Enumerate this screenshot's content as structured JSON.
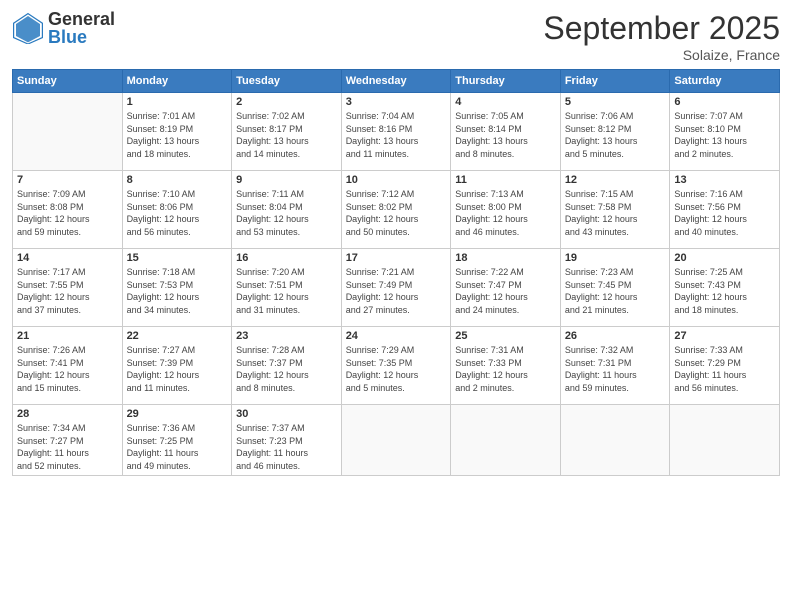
{
  "logo": {
    "general": "General",
    "blue": "Blue"
  },
  "header": {
    "month": "September 2025",
    "location": "Solaize, France"
  },
  "weekdays": [
    "Sunday",
    "Monday",
    "Tuesday",
    "Wednesday",
    "Thursday",
    "Friday",
    "Saturday"
  ],
  "weeks": [
    [
      {
        "day": "",
        "info": ""
      },
      {
        "day": "1",
        "info": "Sunrise: 7:01 AM\nSunset: 8:19 PM\nDaylight: 13 hours\nand 18 minutes."
      },
      {
        "day": "2",
        "info": "Sunrise: 7:02 AM\nSunset: 8:17 PM\nDaylight: 13 hours\nand 14 minutes."
      },
      {
        "day": "3",
        "info": "Sunrise: 7:04 AM\nSunset: 8:16 PM\nDaylight: 13 hours\nand 11 minutes."
      },
      {
        "day": "4",
        "info": "Sunrise: 7:05 AM\nSunset: 8:14 PM\nDaylight: 13 hours\nand 8 minutes."
      },
      {
        "day": "5",
        "info": "Sunrise: 7:06 AM\nSunset: 8:12 PM\nDaylight: 13 hours\nand 5 minutes."
      },
      {
        "day": "6",
        "info": "Sunrise: 7:07 AM\nSunset: 8:10 PM\nDaylight: 13 hours\nand 2 minutes."
      }
    ],
    [
      {
        "day": "7",
        "info": "Sunrise: 7:09 AM\nSunset: 8:08 PM\nDaylight: 12 hours\nand 59 minutes."
      },
      {
        "day": "8",
        "info": "Sunrise: 7:10 AM\nSunset: 8:06 PM\nDaylight: 12 hours\nand 56 minutes."
      },
      {
        "day": "9",
        "info": "Sunrise: 7:11 AM\nSunset: 8:04 PM\nDaylight: 12 hours\nand 53 minutes."
      },
      {
        "day": "10",
        "info": "Sunrise: 7:12 AM\nSunset: 8:02 PM\nDaylight: 12 hours\nand 50 minutes."
      },
      {
        "day": "11",
        "info": "Sunrise: 7:13 AM\nSunset: 8:00 PM\nDaylight: 12 hours\nand 46 minutes."
      },
      {
        "day": "12",
        "info": "Sunrise: 7:15 AM\nSunset: 7:58 PM\nDaylight: 12 hours\nand 43 minutes."
      },
      {
        "day": "13",
        "info": "Sunrise: 7:16 AM\nSunset: 7:56 PM\nDaylight: 12 hours\nand 40 minutes."
      }
    ],
    [
      {
        "day": "14",
        "info": "Sunrise: 7:17 AM\nSunset: 7:55 PM\nDaylight: 12 hours\nand 37 minutes."
      },
      {
        "day": "15",
        "info": "Sunrise: 7:18 AM\nSunset: 7:53 PM\nDaylight: 12 hours\nand 34 minutes."
      },
      {
        "day": "16",
        "info": "Sunrise: 7:20 AM\nSunset: 7:51 PM\nDaylight: 12 hours\nand 31 minutes."
      },
      {
        "day": "17",
        "info": "Sunrise: 7:21 AM\nSunset: 7:49 PM\nDaylight: 12 hours\nand 27 minutes."
      },
      {
        "day": "18",
        "info": "Sunrise: 7:22 AM\nSunset: 7:47 PM\nDaylight: 12 hours\nand 24 minutes."
      },
      {
        "day": "19",
        "info": "Sunrise: 7:23 AM\nSunset: 7:45 PM\nDaylight: 12 hours\nand 21 minutes."
      },
      {
        "day": "20",
        "info": "Sunrise: 7:25 AM\nSunset: 7:43 PM\nDaylight: 12 hours\nand 18 minutes."
      }
    ],
    [
      {
        "day": "21",
        "info": "Sunrise: 7:26 AM\nSunset: 7:41 PM\nDaylight: 12 hours\nand 15 minutes."
      },
      {
        "day": "22",
        "info": "Sunrise: 7:27 AM\nSunset: 7:39 PM\nDaylight: 12 hours\nand 11 minutes."
      },
      {
        "day": "23",
        "info": "Sunrise: 7:28 AM\nSunset: 7:37 PM\nDaylight: 12 hours\nand 8 minutes."
      },
      {
        "day": "24",
        "info": "Sunrise: 7:29 AM\nSunset: 7:35 PM\nDaylight: 12 hours\nand 5 minutes."
      },
      {
        "day": "25",
        "info": "Sunrise: 7:31 AM\nSunset: 7:33 PM\nDaylight: 12 hours\nand 2 minutes."
      },
      {
        "day": "26",
        "info": "Sunrise: 7:32 AM\nSunset: 7:31 PM\nDaylight: 11 hours\nand 59 minutes."
      },
      {
        "day": "27",
        "info": "Sunrise: 7:33 AM\nSunset: 7:29 PM\nDaylight: 11 hours\nand 56 minutes."
      }
    ],
    [
      {
        "day": "28",
        "info": "Sunrise: 7:34 AM\nSunset: 7:27 PM\nDaylight: 11 hours\nand 52 minutes."
      },
      {
        "day": "29",
        "info": "Sunrise: 7:36 AM\nSunset: 7:25 PM\nDaylight: 11 hours\nand 49 minutes."
      },
      {
        "day": "30",
        "info": "Sunrise: 7:37 AM\nSunset: 7:23 PM\nDaylight: 11 hours\nand 46 minutes."
      },
      {
        "day": "",
        "info": ""
      },
      {
        "day": "",
        "info": ""
      },
      {
        "day": "",
        "info": ""
      },
      {
        "day": "",
        "info": ""
      }
    ]
  ]
}
